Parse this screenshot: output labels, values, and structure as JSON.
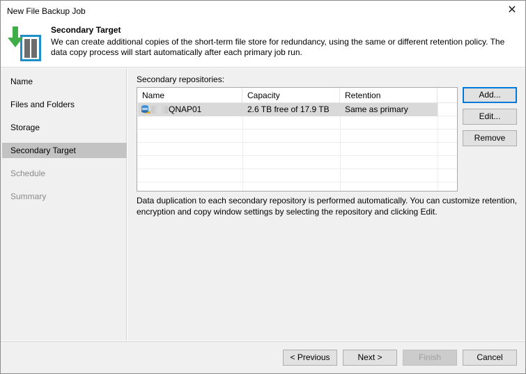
{
  "window": {
    "title": "New File Backup Job",
    "close_glyph": "✕"
  },
  "header": {
    "title": "Secondary Target",
    "description": "We can create additional copies of the short-term file store for redundancy, using the same or different retention policy. The data copy process will start automatically after each primary job run.",
    "icon": "backup-job-icon",
    "colors": {
      "arrow": "#3fae49",
      "server": "#1e8fc6"
    }
  },
  "sidebar": {
    "items": [
      {
        "label": "Name",
        "state": "normal"
      },
      {
        "label": "Files and Folders",
        "state": "normal"
      },
      {
        "label": "Storage",
        "state": "normal"
      },
      {
        "label": "Secondary Target",
        "state": "active"
      },
      {
        "label": "Schedule",
        "state": "disabled"
      },
      {
        "label": "Summary",
        "state": "disabled"
      }
    ]
  },
  "main": {
    "repositories_label": "Secondary repositories:",
    "columns": [
      "Name",
      "Capacity",
      "Retention"
    ],
    "rows": [
      {
        "name": "QNAP01",
        "capacity": "2.6 TB free of 17.9 TB",
        "retention": "Same as primary",
        "icon": "repository-icon"
      }
    ],
    "buttons": {
      "add": "Add...",
      "edit": "Edit...",
      "remove": "Remove"
    },
    "info": "Data duplication to each secondary repository is performed automatically. You can customize retention, encryption and copy window settings by selecting the repository and clicking Edit."
  },
  "footer": {
    "previous": "< Previous",
    "next": "Next >",
    "finish": "Finish",
    "cancel": "Cancel"
  },
  "colors": {
    "accent": "#0078d7",
    "selection": "#d9d9d9",
    "active_nav": "#c3c3c3"
  }
}
